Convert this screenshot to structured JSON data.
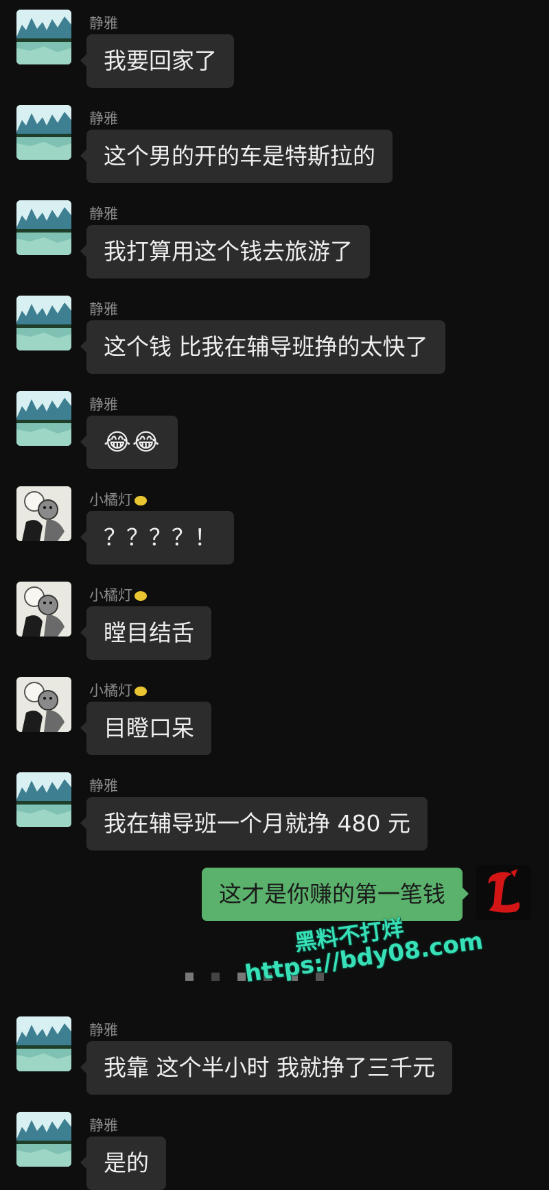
{
  "colors": {
    "background": "#0e0e0e",
    "incoming_bubble": "#2c2c2c",
    "outgoing_bubble": "#5bb26c",
    "sender_name": "#8b8b8b",
    "watermark": "#37e0b6"
  },
  "messages": [
    {
      "sender": "静雅",
      "text": "我要回家了",
      "avatar_icon": "lake-landscape-icon"
    },
    {
      "sender": "静雅",
      "text": "这个男的开的车是特斯拉的",
      "avatar_icon": "lake-landscape-icon"
    },
    {
      "sender": "静雅",
      "text": "我打算用这个钱去旅游了",
      "avatar_icon": "lake-landscape-icon"
    },
    {
      "sender": "静雅",
      "text": "这个钱 比我在辅导班挣的太快了",
      "avatar_icon": "lake-landscape-icon"
    },
    {
      "sender": "静雅",
      "text": "😂😂",
      "avatar_icon": "lake-landscape-icon"
    },
    {
      "sender": "小橘灯",
      "text": "？？？？！",
      "avatar_icon": "cartoon-character-icon"
    },
    {
      "sender": "小橘灯",
      "text": "瞠目结舌",
      "avatar_icon": "cartoon-character-icon"
    },
    {
      "sender": "小橘灯",
      "text": "目瞪口呆",
      "avatar_icon": "cartoon-character-icon"
    },
    {
      "sender": "静雅",
      "text": "我在辅导班一个月就挣 480 元",
      "avatar_icon": "lake-landscape-icon"
    },
    {
      "sender": "",
      "text": "这才是你赚的第一笔钱",
      "avatar_icon": "red-letter-l-icon",
      "outgoing": true
    },
    {
      "sender": "静雅",
      "text": "我靠 这个半小时 我就挣了三千元",
      "avatar_icon": "lake-landscape-icon"
    },
    {
      "sender": "静雅",
      "text": "是的",
      "avatar_icon": "lake-landscape-icon"
    }
  ],
  "watermark": {
    "line1": "黑料不打烊",
    "line2": "https://bdy08.com"
  }
}
